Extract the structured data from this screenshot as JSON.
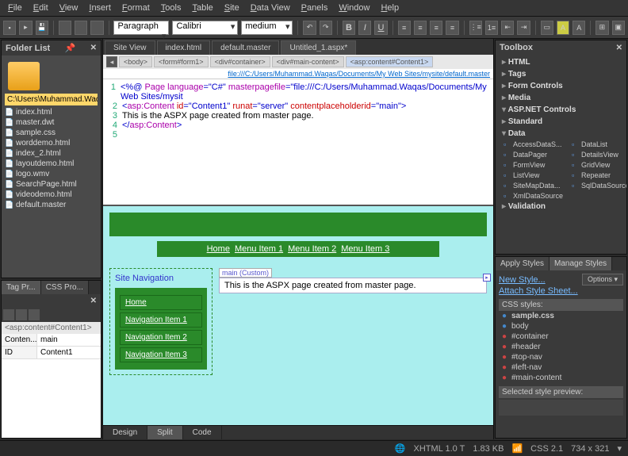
{
  "menu": [
    "File",
    "Edit",
    "View",
    "Insert",
    "Format",
    "Tools",
    "Table",
    "Site",
    "Data View",
    "Panels",
    "Window",
    "Help"
  ],
  "toolbar": {
    "style": "Paragraph",
    "font": "Calibri",
    "size": "medium"
  },
  "folderList": {
    "title": "Folder List",
    "root": "C:\\Users\\Muhammad.Waqas\\Do",
    "files": [
      "index.html",
      "master.dwt",
      "sample.css",
      "worddemo.html",
      "index_2.html",
      "layoutdemo.html",
      "logo.wmv",
      "SearchPage.html",
      "videodemo.html",
      "default.master"
    ]
  },
  "tagPanel": {
    "tabs": [
      "Tag Pr...",
      "CSS Pro..."
    ],
    "crumb": "<asp:content#Content1>",
    "rows": [
      [
        "Conten...",
        "main"
      ],
      [
        "ID",
        "Content1"
      ]
    ]
  },
  "docTabs": [
    "Site View",
    "index.html",
    "default.master",
    "Untitled_1.aspx*"
  ],
  "activeDoc": 3,
  "breadcrumb": [
    "<body>",
    "<form#form1>",
    "<div#container>",
    "<div#main-content>",
    "<asp:content#Content1>"
  ],
  "filePath": "file:///C:/Users/Muhammad.Waqas/Documents/My Web Sites/mysite/default.master",
  "code": [
    {
      "n": "1",
      "parts": [
        {
          "c": "kw-bl",
          "t": "<%@ "
        },
        {
          "c": "kw-mg",
          "t": "Page language"
        },
        {
          "c": "kw-bl",
          "t": "=\"C#\" "
        },
        {
          "c": "kw-mg",
          "t": "masterpagefile"
        },
        {
          "c": "kw-bl",
          "t": "=\"file:///C:/Users/Muhammad.Waqas/Documents/My Web Sites/mysit"
        }
      ]
    },
    {
      "n": "2",
      "parts": [
        {
          "c": "kw-bl",
          "t": "<"
        },
        {
          "c": "kw-mg",
          "t": "asp:Content "
        },
        {
          "c": "kw-rd",
          "t": "id"
        },
        {
          "c": "kw-bl",
          "t": "=\"Content1\" "
        },
        {
          "c": "kw-rd",
          "t": "runat"
        },
        {
          "c": "kw-bl",
          "t": "=\"server\" "
        },
        {
          "c": "kw-rd",
          "t": "contentplaceholderid"
        },
        {
          "c": "kw-bl",
          "t": "=\"main\">"
        }
      ]
    },
    {
      "n": "3",
      "parts": [
        {
          "c": "txt",
          "t": "    This is the ASPX page created from master page."
        }
      ]
    },
    {
      "n": "4",
      "parts": [
        {
          "c": "kw-bl",
          "t": "</"
        },
        {
          "c": "kw-mg",
          "t": "asp:Content"
        },
        {
          "c": "kw-bl",
          "t": ">"
        }
      ]
    },
    {
      "n": "5",
      "parts": []
    }
  ],
  "design": {
    "topnav": [
      "Home",
      "Menu Item 1",
      "Menu Item 2",
      "Menu Item 3"
    ],
    "sideTitle": "Site Navigation",
    "sideItems": [
      "Home",
      "Navigation Item 1",
      "Navigation Item 2",
      "Navigation Item 3"
    ],
    "contentTag": "main (Custom)",
    "contentText": "This is the ASPX page created from master page."
  },
  "viewModes": [
    "Design",
    "Split",
    "Code"
  ],
  "activeView": 1,
  "toolbox": {
    "title": "Toolbox",
    "groups": [
      {
        "name": "HTML",
        "open": false
      },
      {
        "name": "Tags",
        "open": false
      },
      {
        "name": "Form Controls",
        "open": false
      },
      {
        "name": "Media",
        "open": false
      }
    ],
    "aspTitle": "ASP.NET Controls",
    "aspGroups": [
      {
        "name": "Standard",
        "open": false
      },
      {
        "name": "Data",
        "open": true,
        "items": [
          "AccessDataS...",
          "DataList",
          "DataPager",
          "DetailsView",
          "FormView",
          "GridView",
          "ListView",
          "Repeater",
          "SiteMapData...",
          "SqlDataSource",
          "XmlDataSource"
        ]
      },
      {
        "name": "Validation",
        "open": false
      }
    ]
  },
  "styles": {
    "tabs": [
      "Apply Styles",
      "Manage Styles"
    ],
    "activeTab": 1,
    "newStyle": "New Style...",
    "attach": "Attach Style Sheet...",
    "options": "Options ▾",
    "cssTitle": "CSS styles:",
    "sheet": "sample.css",
    "rules": [
      {
        "n": "body",
        "c": "b"
      },
      {
        "n": "#container",
        "c": ""
      },
      {
        "n": "#header",
        "c": ""
      },
      {
        "n": "#top-nav",
        "c": ""
      },
      {
        "n": "#left-nav",
        "c": ""
      },
      {
        "n": "#main-content",
        "c": ""
      }
    ],
    "previewTitle": "Selected style preview:"
  },
  "status": {
    "doctype": "XHTML 1.0 T",
    "size": "1.83 KB",
    "css": "CSS 2.1",
    "dims": "734 x 321"
  }
}
